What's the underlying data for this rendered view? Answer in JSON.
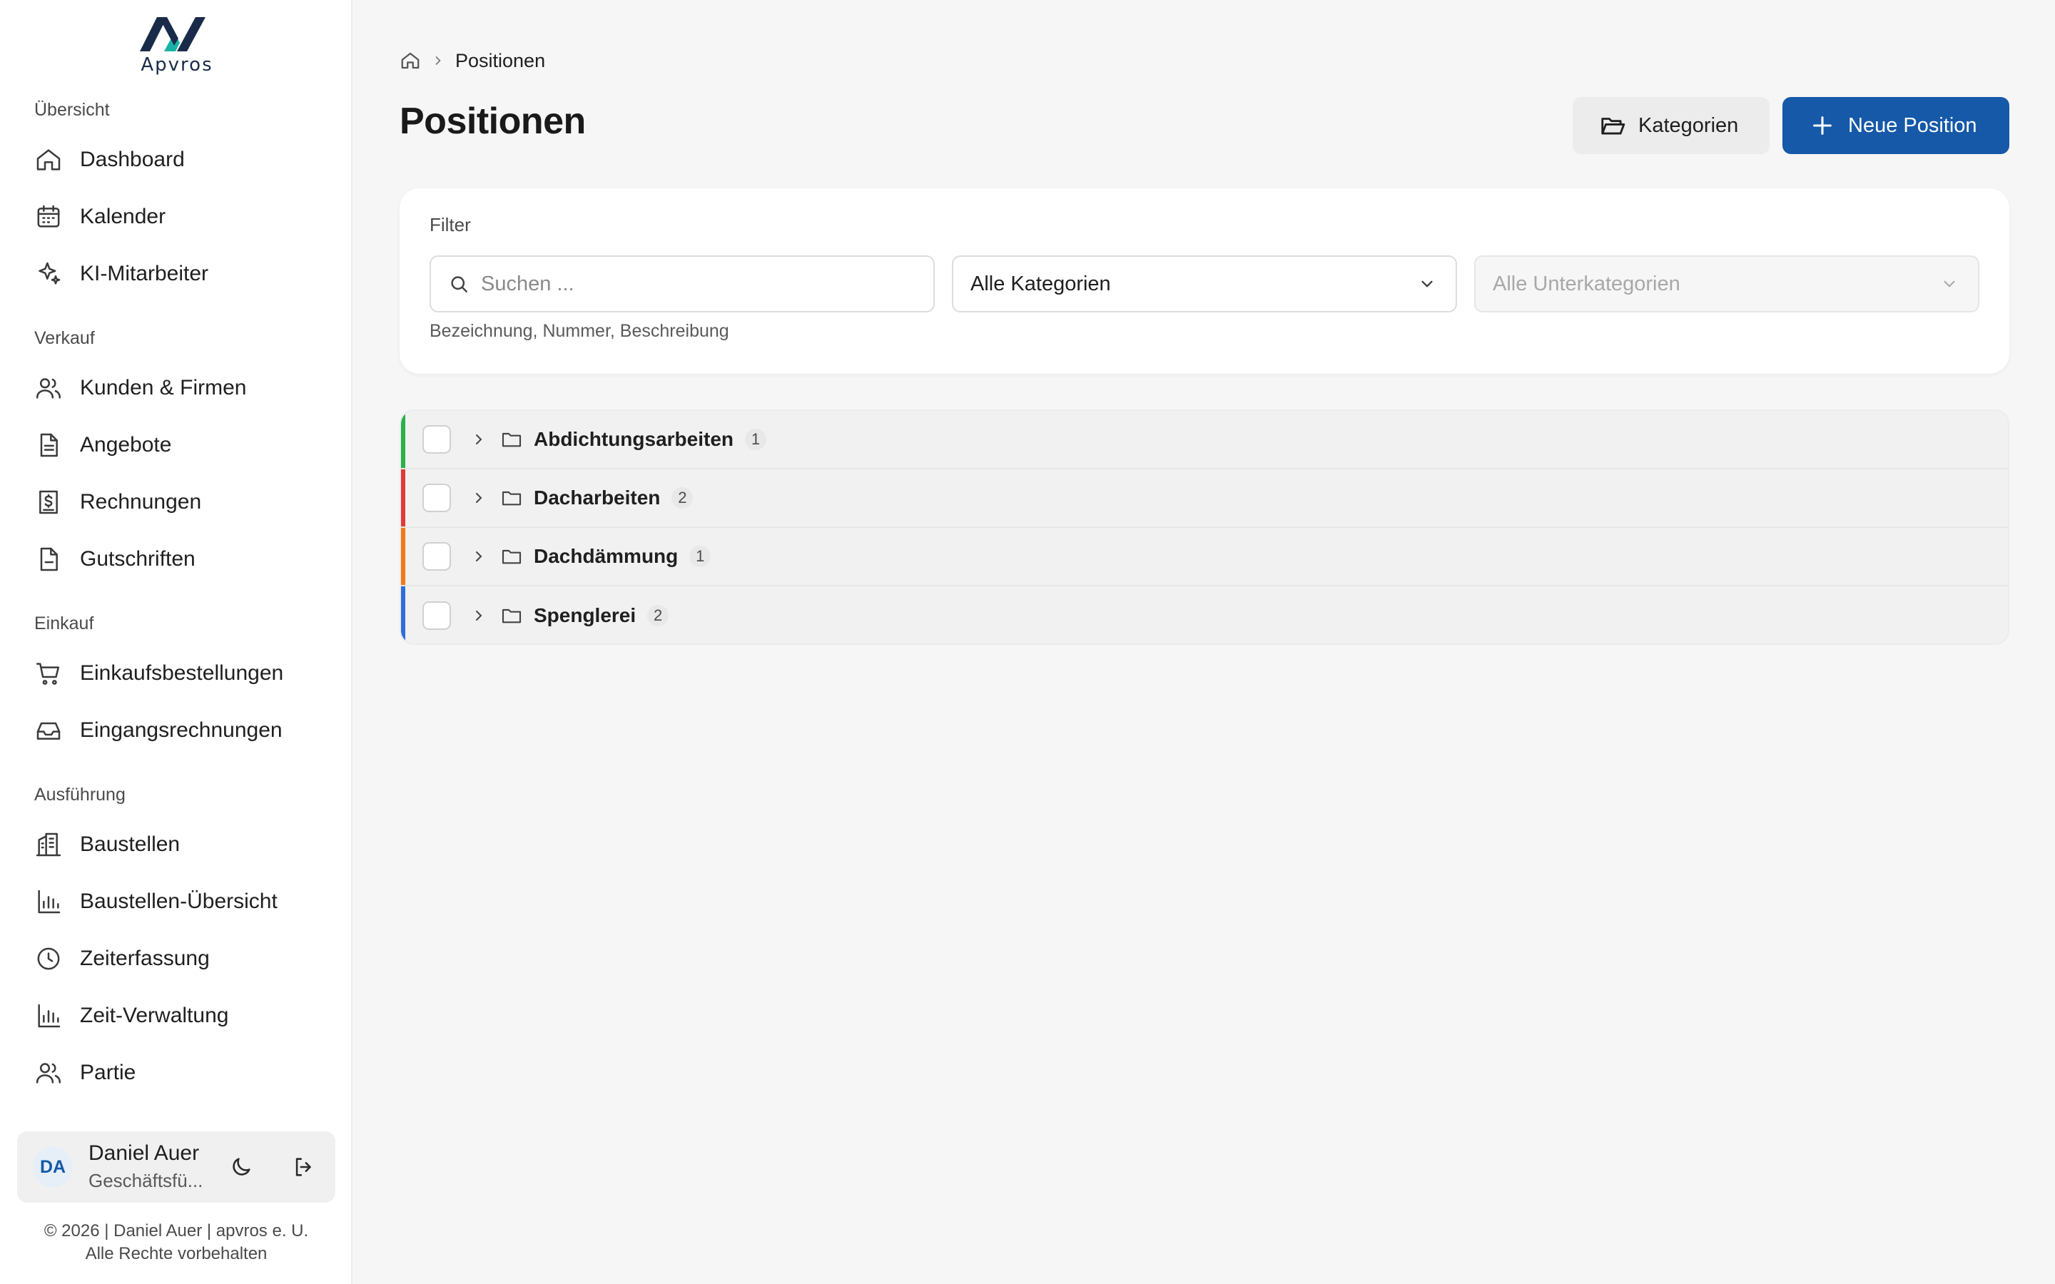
{
  "app": {
    "logo_text": "Apvros",
    "brand_color": "#1559a8",
    "logo_accent": "#19b3a6"
  },
  "sidebar": {
    "sections": [
      {
        "label": "Übersicht",
        "items": [
          {
            "label": "Dashboard",
            "icon": "home-icon"
          },
          {
            "label": "Kalender",
            "icon": "calendar-icon"
          },
          {
            "label": "KI-Mitarbeiter",
            "icon": "sparkles-icon"
          }
        ]
      },
      {
        "label": "Verkauf",
        "items": [
          {
            "label": "Kunden & Firmen",
            "icon": "users-icon"
          },
          {
            "label": "Angebote",
            "icon": "document-icon"
          },
          {
            "label": "Rechnungen",
            "icon": "invoice-dollar-icon"
          },
          {
            "label": "Gutschriften",
            "icon": "document-minus-icon"
          }
        ]
      },
      {
        "label": "Einkauf",
        "items": [
          {
            "label": "Einkaufsbestellungen",
            "icon": "cart-icon"
          },
          {
            "label": "Eingangsrechnungen",
            "icon": "inbox-icon"
          }
        ]
      },
      {
        "label": "Ausführung",
        "items": [
          {
            "label": "Baustellen",
            "icon": "building-icon"
          },
          {
            "label": "Baustellen-Übersicht",
            "icon": "bar-chart-icon"
          },
          {
            "label": "Zeiterfassung",
            "icon": "clock-icon"
          },
          {
            "label": "Zeit-Verwaltung",
            "icon": "bar-chart-icon"
          },
          {
            "label": "Partie",
            "icon": "users-icon"
          }
        ]
      }
    ],
    "user": {
      "initials": "DA",
      "name": "Daniel Auer",
      "role": "Geschäftsfü..."
    },
    "footer": {
      "line1": "© 2026 | Daniel Auer | apvros e. U.",
      "line2": "Alle Rechte vorbehalten"
    }
  },
  "breadcrumb": {
    "current": "Positionen"
  },
  "page": {
    "title": "Positionen"
  },
  "actions": {
    "categories_label": "Kategorien",
    "new_label": "Neue Position"
  },
  "filter": {
    "label": "Filter",
    "search_placeholder": "Suchen ...",
    "search_value": "",
    "category_value": "Alle Kategorien",
    "subcategory_value": "Alle Unterkategorien",
    "hint": "Bezeichnung, Nummer, Beschreibung"
  },
  "categories": [
    {
      "name": "Abdichtungsarbeiten",
      "count": "1",
      "color": "#2bb04a"
    },
    {
      "name": "Dacharbeiten",
      "count": "2",
      "color": "#e03a3a"
    },
    {
      "name": "Dachdämmung",
      "count": "1",
      "color": "#f07a1a"
    },
    {
      "name": "Spenglerei",
      "count": "2",
      "color": "#2f6fd6"
    }
  ]
}
